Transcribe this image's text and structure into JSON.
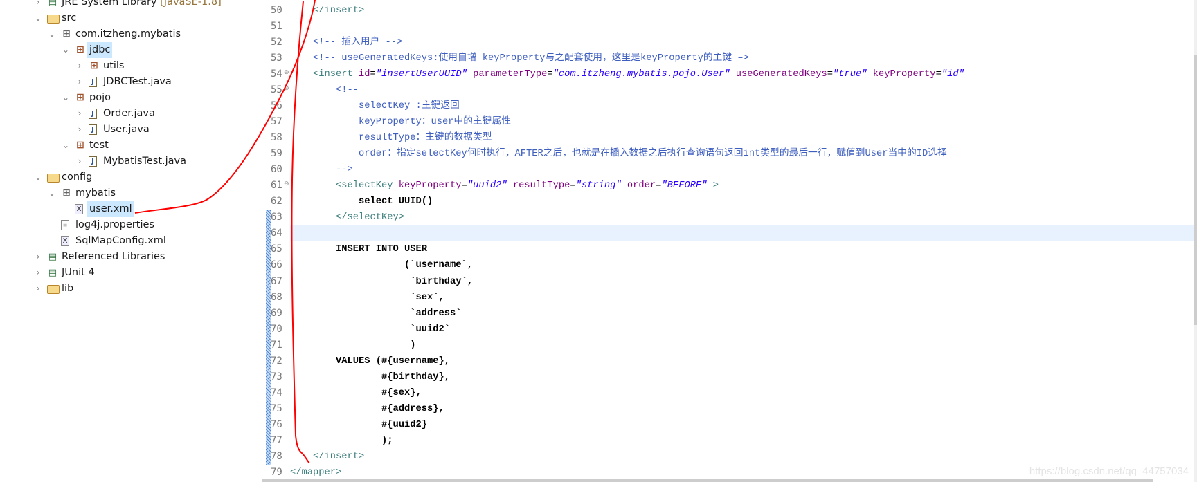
{
  "explorer": {
    "items": [
      {
        "label": "JRE System Library",
        "decoration": "[JavaSE-1.8]",
        "level": 0,
        "icon": "library-icon",
        "state": "collapsed"
      },
      {
        "label": "src",
        "level": 0,
        "icon": "source-folder-icon",
        "state": "expanded"
      },
      {
        "label": "com.itzheng.mybatis",
        "level": 1,
        "icon": "empty-package-icon",
        "state": "expanded"
      },
      {
        "label": "jdbc",
        "level": 2,
        "icon": "package-icon",
        "state": "expanded",
        "selected": true
      },
      {
        "label": "utils",
        "level": 3,
        "icon": "package-icon",
        "state": "collapsed"
      },
      {
        "label": "JDBCTest.java",
        "level": 3,
        "icon": "java-file-icon",
        "state": "collapsed"
      },
      {
        "label": "pojo",
        "level": 2,
        "icon": "package-icon",
        "state": "expanded"
      },
      {
        "label": "Order.java",
        "level": 3,
        "icon": "java-file-icon",
        "state": "collapsed"
      },
      {
        "label": "User.java",
        "level": 3,
        "icon": "java-file-icon",
        "state": "collapsed"
      },
      {
        "label": "test",
        "level": 2,
        "icon": "package-icon",
        "state": "expanded"
      },
      {
        "label": "MybatisTest.java",
        "level": 3,
        "icon": "java-file-icon",
        "state": "collapsed"
      },
      {
        "label": "config",
        "level": 0,
        "icon": "source-folder-icon",
        "state": "expanded"
      },
      {
        "label": "mybatis",
        "level": 1,
        "icon": "empty-package-icon",
        "state": "expanded"
      },
      {
        "label": "user.xml",
        "level": 2,
        "icon": "xml-file-icon",
        "state": "none",
        "selected": true
      },
      {
        "label": "log4j.properties",
        "level": 1,
        "icon": "properties-file-icon",
        "state": "none"
      },
      {
        "label": "SqlMapConfig.xml",
        "level": 1,
        "icon": "xml-file-icon",
        "state": "none"
      },
      {
        "label": "Referenced Libraries",
        "level": 0,
        "icon": "library-icon",
        "state": "collapsed"
      },
      {
        "label": "JUnit 4",
        "level": 0,
        "icon": "library-icon",
        "state": "collapsed"
      },
      {
        "label": "lib",
        "level": 0,
        "icon": "folder-icon",
        "state": "collapsed"
      }
    ]
  },
  "editor": {
    "current_line": 64,
    "lines": [
      {
        "n": "50",
        "tokens": [
          {
            "c": "tag",
            "t": "    </insert>"
          }
        ]
      },
      {
        "n": "51",
        "tokens": []
      },
      {
        "n": "52",
        "tokens": [
          {
            "c": "cmt",
            "t": "    <!-- 插入用户 -->"
          }
        ]
      },
      {
        "n": "53",
        "tokens": [
          {
            "c": "cmt",
            "t": "    <!-- useGeneratedKeys:使用自增 keyProperty与之配套使用，这里是keyProperty的主键 –>"
          }
        ]
      },
      {
        "n": "54",
        "fold": true,
        "tokens": [
          {
            "c": "tag",
            "t": "    <insert "
          },
          {
            "c": "attr",
            "t": "id"
          },
          {
            "c": "eq",
            "t": "="
          },
          {
            "c": "val",
            "t": "\"insertUserUUID\""
          },
          {
            "c": "eq",
            "t": " "
          },
          {
            "c": "attr",
            "t": "parameterType"
          },
          {
            "c": "eq",
            "t": "="
          },
          {
            "c": "val",
            "t": "\"com.itzheng.mybatis.pojo.User\""
          },
          {
            "c": "eq",
            "t": " "
          },
          {
            "c": "attr",
            "t": "useGeneratedKeys"
          },
          {
            "c": "eq",
            "t": "="
          },
          {
            "c": "val",
            "t": "\"true\""
          },
          {
            "c": "eq",
            "t": " "
          },
          {
            "c": "attr",
            "t": "keyProperty"
          },
          {
            "c": "eq",
            "t": "="
          },
          {
            "c": "val",
            "t": "\"id\""
          }
        ]
      },
      {
        "n": "55",
        "fold": true,
        "tokens": [
          {
            "c": "cmt",
            "t": "        <!--"
          }
        ]
      },
      {
        "n": "56",
        "tokens": [
          {
            "c": "cmt",
            "t": "            selectKey :主键返回"
          }
        ]
      },
      {
        "n": "57",
        "tokens": [
          {
            "c": "cmt",
            "t": "            keyProperty：user中的主键属性"
          }
        ]
      },
      {
        "n": "58",
        "tokens": [
          {
            "c": "cmt",
            "t": "            resultType：主键的数据类型"
          }
        ]
      },
      {
        "n": "59",
        "tokens": [
          {
            "c": "cmt",
            "t": "            order：指定selectKey何时执行，AFTER之后，也就是在插入数据之后执行查询语句返回int类型的最后一行，赋值到User当中的ID选择"
          }
        ]
      },
      {
        "n": "60",
        "tokens": [
          {
            "c": "cmt",
            "t": "        -->"
          }
        ]
      },
      {
        "n": "61",
        "fold": true,
        "tokens": [
          {
            "c": "tag",
            "t": "        <selectKey "
          },
          {
            "c": "attr",
            "t": "keyProperty"
          },
          {
            "c": "eq",
            "t": "="
          },
          {
            "c": "val",
            "t": "\"uuid2\""
          },
          {
            "c": "eq",
            "t": " "
          },
          {
            "c": "attr",
            "t": "resultType"
          },
          {
            "c": "eq",
            "t": "="
          },
          {
            "c": "val",
            "t": "\"string\""
          },
          {
            "c": "eq",
            "t": " "
          },
          {
            "c": "attr",
            "t": "order"
          },
          {
            "c": "eq",
            "t": "="
          },
          {
            "c": "val",
            "t": "\"BEFORE\""
          },
          {
            "c": "tag",
            "t": " >"
          }
        ]
      },
      {
        "n": "62",
        "tokens": [
          {
            "c": "txt",
            "t": "            select UUID()"
          }
        ]
      },
      {
        "n": "63",
        "tokens": [
          {
            "c": "tag",
            "t": "        </selectKey>"
          }
        ]
      },
      {
        "n": "64",
        "tokens": []
      },
      {
        "n": "65",
        "tokens": [
          {
            "c": "txt",
            "t": "        INSERT INTO USER"
          }
        ]
      },
      {
        "n": "66",
        "tokens": [
          {
            "c": "txt",
            "t": "                    (`username`,"
          }
        ]
      },
      {
        "n": "67",
        "tokens": [
          {
            "c": "txt",
            "t": "                     `birthday`,"
          }
        ]
      },
      {
        "n": "68",
        "tokens": [
          {
            "c": "txt",
            "t": "                     `sex`,"
          }
        ]
      },
      {
        "n": "69",
        "tokens": [
          {
            "c": "txt",
            "t": "                     `address`"
          }
        ]
      },
      {
        "n": "70",
        "tokens": [
          {
            "c": "txt",
            "t": "                     `uuid2`"
          }
        ]
      },
      {
        "n": "71",
        "tokens": [
          {
            "c": "txt",
            "t": "                     )"
          }
        ]
      },
      {
        "n": "72",
        "tokens": [
          {
            "c": "txt",
            "t": "        VALUES (#{username},"
          }
        ]
      },
      {
        "n": "73",
        "tokens": [
          {
            "c": "txt",
            "t": "                #{birthday},"
          }
        ]
      },
      {
        "n": "74",
        "tokens": [
          {
            "c": "txt",
            "t": "                #{sex},"
          }
        ]
      },
      {
        "n": "75",
        "tokens": [
          {
            "c": "txt",
            "t": "                #{address},"
          }
        ]
      },
      {
        "n": "76",
        "tokens": [
          {
            "c": "txt",
            "t": "                #{uuid2}"
          }
        ]
      },
      {
        "n": "77",
        "tokens": [
          {
            "c": "txt",
            "t": "                );"
          }
        ]
      },
      {
        "n": "78",
        "tokens": [
          {
            "c": "tag",
            "t": "    </insert>"
          }
        ]
      },
      {
        "n": "79",
        "tokens": [
          {
            "c": "tag",
            "t": "</mapper>"
          }
        ]
      }
    ]
  },
  "watermark": "https://blog.csdn.net/qq_44757034",
  "colors": {
    "tag": "#3f7f7f",
    "attribute": "#7f007f",
    "value": "#2a00ff",
    "comment": "#3f5fbf",
    "annotation": "#ff0000",
    "current_line": "#e8f2fe"
  }
}
